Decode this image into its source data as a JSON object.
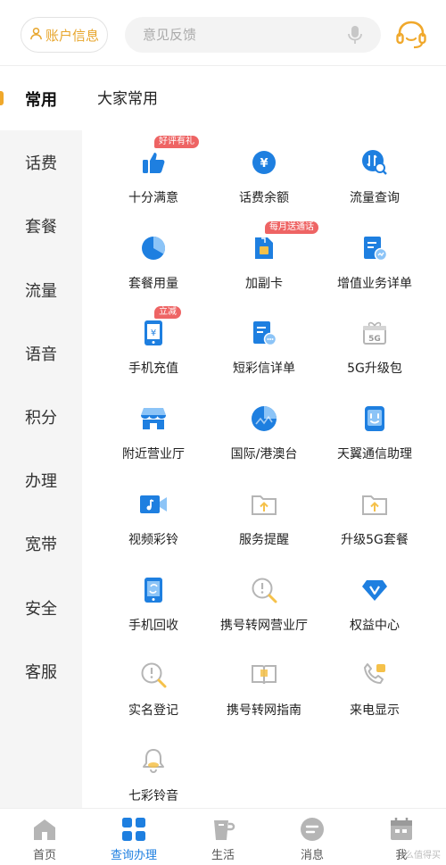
{
  "header": {
    "account_label": "账户信息",
    "search_placeholder": "意见反馈"
  },
  "sidebar": {
    "items": [
      {
        "label": "常用",
        "active": true
      },
      {
        "label": "话费"
      },
      {
        "label": "套餐"
      },
      {
        "label": "流量"
      },
      {
        "label": "语音"
      },
      {
        "label": "积分"
      },
      {
        "label": "办理"
      },
      {
        "label": "宽带"
      },
      {
        "label": "安全"
      },
      {
        "label": "客服"
      }
    ]
  },
  "main": {
    "section_title": "大家常用",
    "tiles": [
      {
        "label": "十分满意",
        "icon": "thumbs-up-icon",
        "badge": "好评有礼"
      },
      {
        "label": "话费余额",
        "icon": "yuan-coin-icon"
      },
      {
        "label": "流量查询",
        "icon": "data-search-icon"
      },
      {
        "label": "套餐用量",
        "icon": "pie-chart-icon"
      },
      {
        "label": "加副卡",
        "icon": "sim-card-icon",
        "badge": "每月送通话"
      },
      {
        "label": "增值业务详单",
        "icon": "bill-chart-icon"
      },
      {
        "label": "手机充值",
        "icon": "phone-recharge-icon",
        "badge": "立减"
      },
      {
        "label": "短彩信详单",
        "icon": "sms-bill-icon"
      },
      {
        "label": "5G升级包",
        "icon": "5g-gift-icon",
        "icon_text": "5G"
      },
      {
        "label": "附近营业厅",
        "icon": "store-icon"
      },
      {
        "label": "国际/港澳台",
        "icon": "globe-icon"
      },
      {
        "label": "天翼通信助理",
        "icon": "assistant-icon"
      },
      {
        "label": "视频彩铃",
        "icon": "video-ringtone-icon"
      },
      {
        "label": "服务提醒",
        "icon": "folder-upload-icon"
      },
      {
        "label": "升级5G套餐",
        "icon": "folder-upgrade-icon"
      },
      {
        "label": "手机回收",
        "icon": "phone-recycle-icon"
      },
      {
        "label": "携号转网营业厅",
        "icon": "transfer-search-icon"
      },
      {
        "label": "权益中心",
        "icon": "v-diamond-icon"
      },
      {
        "label": "实名登记",
        "icon": "realname-search-icon"
      },
      {
        "label": "携号转网指南",
        "icon": "book-icon"
      },
      {
        "label": "来电显示",
        "icon": "phone-call-icon"
      },
      {
        "label": "七彩铃音",
        "icon": "bell-icon"
      }
    ]
  },
  "bottom_nav": {
    "items": [
      {
        "label": "首页",
        "icon": "home-icon"
      },
      {
        "label": "查询办理",
        "icon": "grid-icon",
        "active": true
      },
      {
        "label": "生活",
        "icon": "life-cup-icon"
      },
      {
        "label": "消息",
        "icon": "message-icon"
      },
      {
        "label": "我",
        "icon": "calendar-icon"
      }
    ]
  },
  "watermark": "什么值得买",
  "colors": {
    "accent_orange": "#f0a82b",
    "icon_blue": "#1e7fe0",
    "badge_red": "#ee6464",
    "icon_grey": "#b5b5b5",
    "icon_yellow": "#f5c14a"
  }
}
